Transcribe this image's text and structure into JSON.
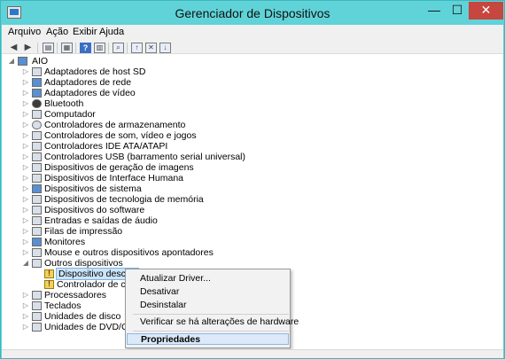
{
  "window": {
    "title": "Gerenciador de Dispositivos",
    "minimize_glyph": "—",
    "maximize_glyph": "☐",
    "close_glyph": "✕",
    "frame_color": "#5fd3d8"
  },
  "menu": {
    "items": [
      "Arquivo",
      "Ação",
      "Exibir",
      "Ajuda"
    ]
  },
  "toolbar": {
    "icons": [
      "back-icon",
      "forward-icon",
      "properties-view-icon",
      "show-hidden-icon",
      "help-icon",
      "details-icon",
      "scan-hardware-icon",
      "update-driver-icon",
      "uninstall-icon",
      "disable-icon"
    ]
  },
  "tree": {
    "root": "AIO",
    "root_expander": "◢",
    "collapsed_expander": "▷",
    "expanded_expander": "◢",
    "categories": [
      {
        "label": "Adaptadores de host SD",
        "icon": "sd-host-icon"
      },
      {
        "label": "Adaptadores de rede",
        "icon": "network-adapter-icon"
      },
      {
        "label": "Adaptadores de vídeo",
        "icon": "display-adapter-icon"
      },
      {
        "label": "Bluetooth",
        "icon": "bluetooth-icon"
      },
      {
        "label": "Computador",
        "icon": "computer-icon"
      },
      {
        "label": "Controladores de armazenamento",
        "icon": "storage-controller-icon"
      },
      {
        "label": "Controladores de som, vídeo e jogos",
        "icon": "sound-icon"
      },
      {
        "label": "Controladores IDE ATA/ATAPI",
        "icon": "ide-controller-icon"
      },
      {
        "label": "Controladores USB (barramento serial universal)",
        "icon": "usb-icon"
      },
      {
        "label": "Dispositivos de geração de imagens",
        "icon": "imaging-device-icon"
      },
      {
        "label": "Dispositivos de Interface Humana",
        "icon": "hid-icon"
      },
      {
        "label": "Dispositivos de sistema",
        "icon": "system-device-icon"
      },
      {
        "label": "Dispositivos de tecnologia de memória",
        "icon": "memory-tech-icon"
      },
      {
        "label": "Dispositivos do software",
        "icon": "software-device-icon"
      },
      {
        "label": "Entradas e saídas de áudio",
        "icon": "audio-io-icon"
      },
      {
        "label": "Filas de impressão",
        "icon": "print-queue-icon"
      },
      {
        "label": "Monitores",
        "icon": "monitor-icon"
      },
      {
        "label": "Mouse e outros dispositivos apontadores",
        "icon": "mouse-icon"
      },
      {
        "label": "Outros dispositivos",
        "icon": "other-devices-icon",
        "expanded": true
      }
    ],
    "other_children": [
      {
        "label": "Dispositivo descon",
        "icon": "warning-device-icon",
        "selected": true
      },
      {
        "label": "Controlador de com",
        "icon": "warning-device-icon"
      }
    ],
    "after_categories": [
      {
        "label": "Processadores",
        "icon": "processor-icon"
      },
      {
        "label": "Teclados",
        "icon": "keyboard-icon"
      },
      {
        "label": "Unidades de disco",
        "icon": "disk-drive-icon"
      },
      {
        "label": "Unidades de DVD/CD-R",
        "icon": "dvd-drive-icon"
      }
    ]
  },
  "context_menu": {
    "items": [
      {
        "label": "Atualizar Driver..."
      },
      {
        "label": "Desativar"
      },
      {
        "label": "Desinstalar"
      },
      {
        "label": "Verificar se há alterações de hardware"
      },
      {
        "label": "Propriedades"
      }
    ]
  }
}
